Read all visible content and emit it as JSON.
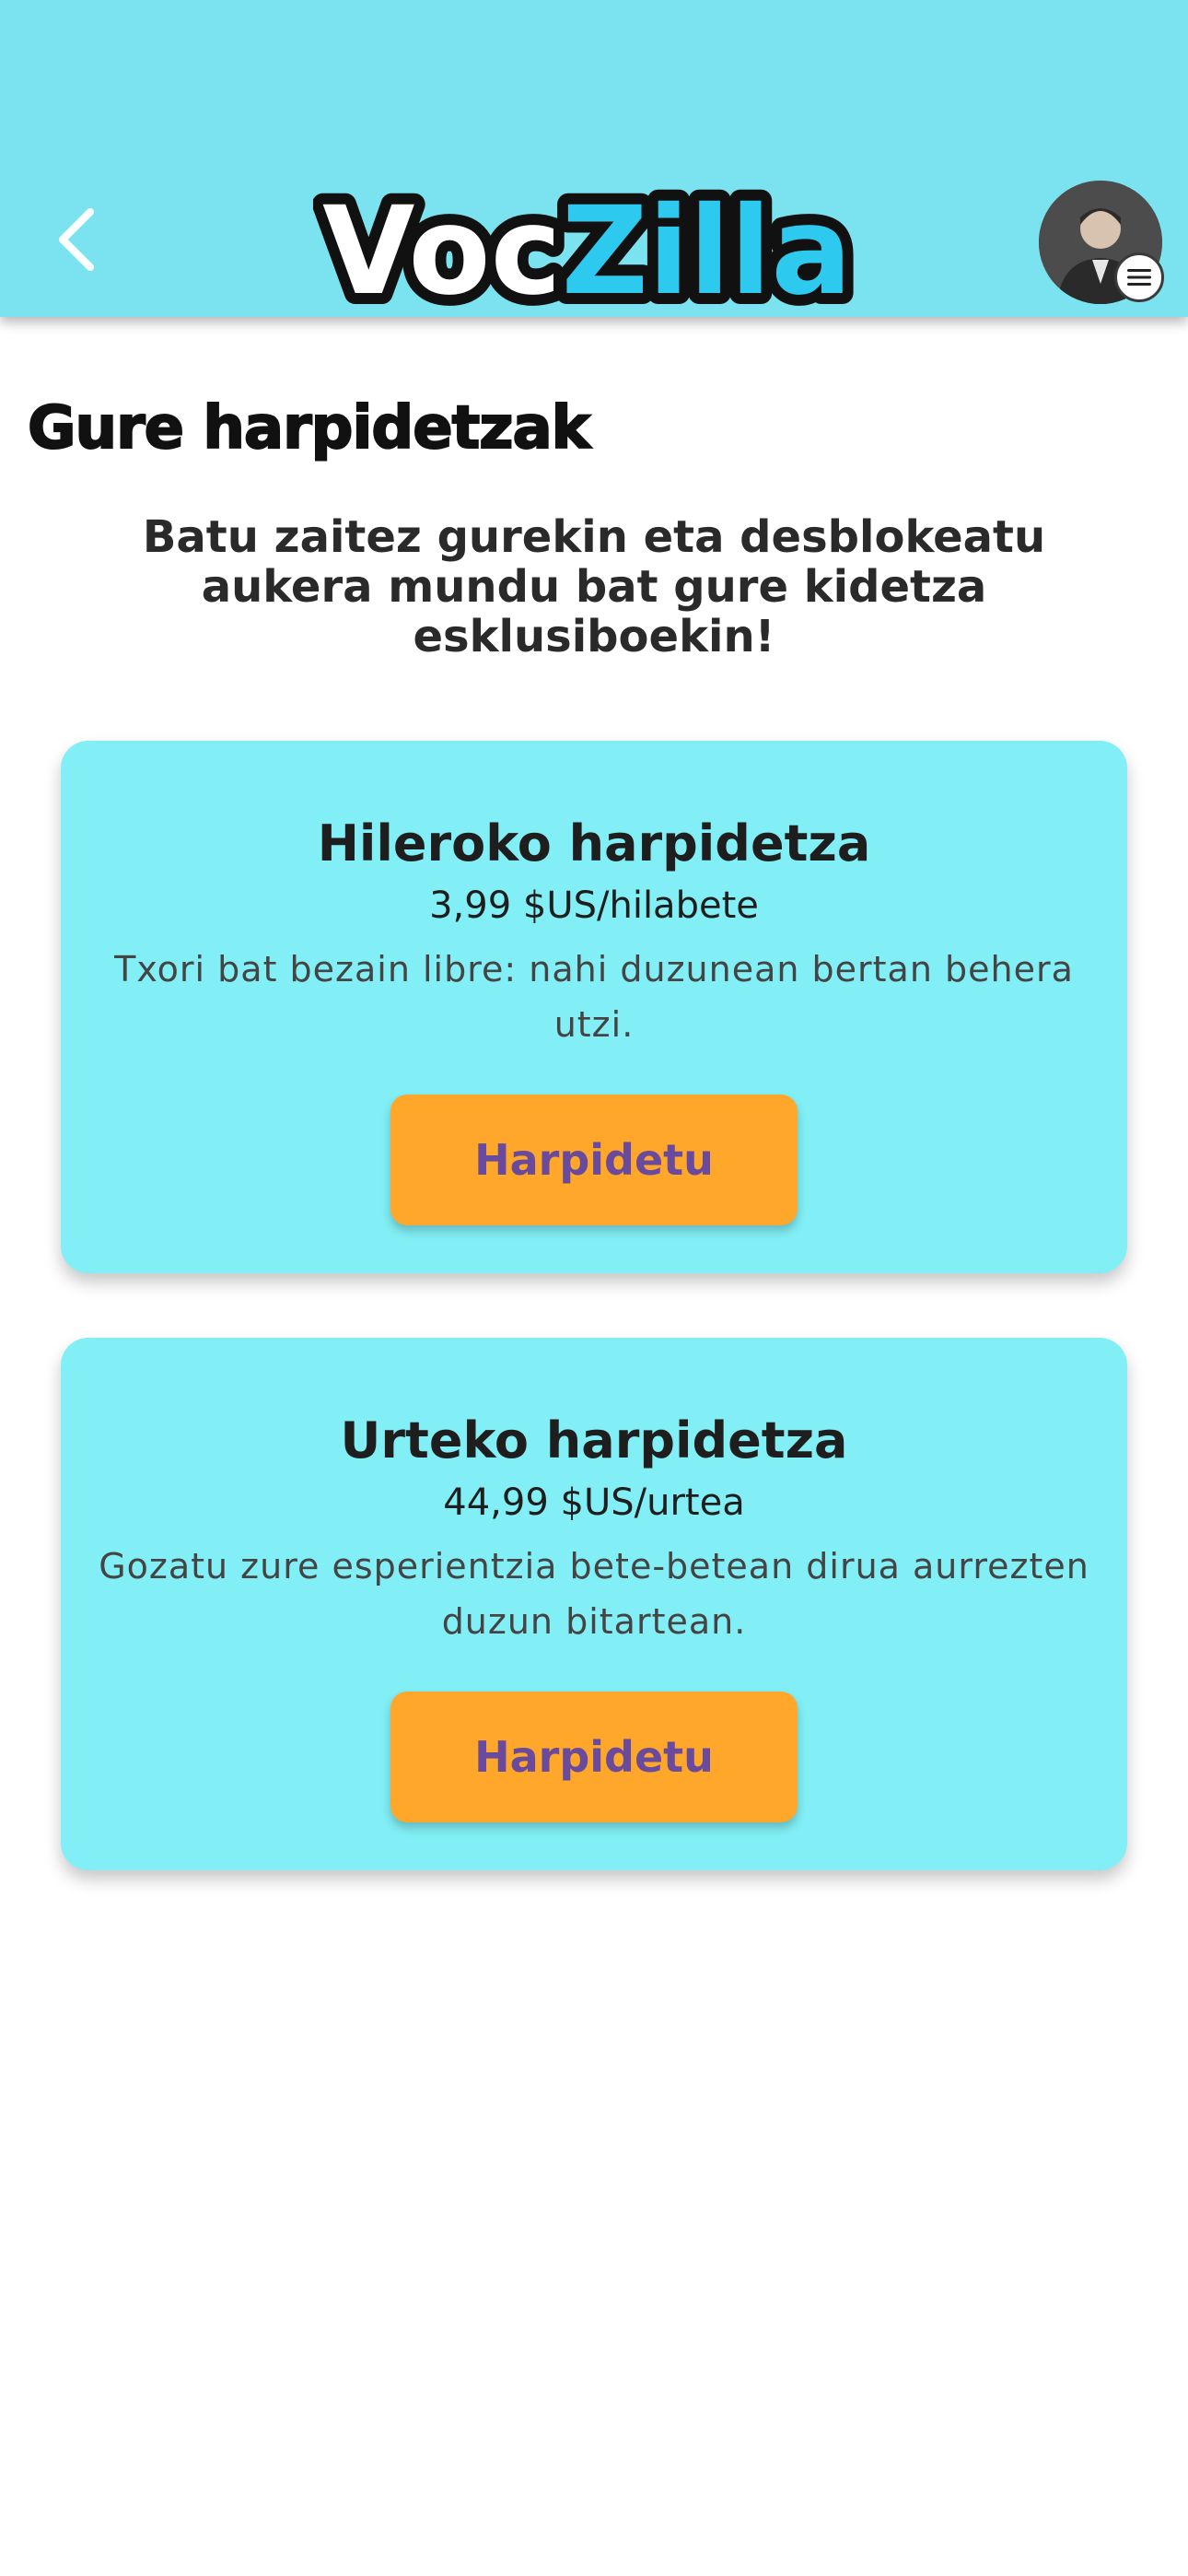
{
  "header": {
    "logo_text_1": "Voc",
    "logo_text_2": "Zilla",
    "back_icon": "chevron-left-icon",
    "avatar_icon": "user-avatar",
    "menu_icon": "hamburger-menu-icon",
    "colors": {
      "bar": "#7be3ef",
      "logo_blue": "#2ec9ef",
      "logo_outline": "#111111"
    }
  },
  "page": {
    "heading": "Gure harpidetzak",
    "intro": "Batu zaitez gurekin eta desblokeatu aukera mundu bat gure kidetza esklusiboekin!"
  },
  "plans": [
    {
      "title": "Hileroko harpidetza",
      "price": "3,99 $US/hilabete",
      "description": "Txori bat bezain libre: nahi duzunean bertan behera utzi.",
      "button_label": "Harpidetu"
    },
    {
      "title": "Urteko harpidetza",
      "price": "44,99 $US/urtea",
      "description": "Gozatu zure esperientzia bete-betean dirua aurrezten duzun bitartean.",
      "button_label": "Harpidetu"
    }
  ],
  "colors": {
    "card_bg": "#81eff5",
    "button_bg": "#fea72a",
    "button_text": "#6a4a9c"
  }
}
